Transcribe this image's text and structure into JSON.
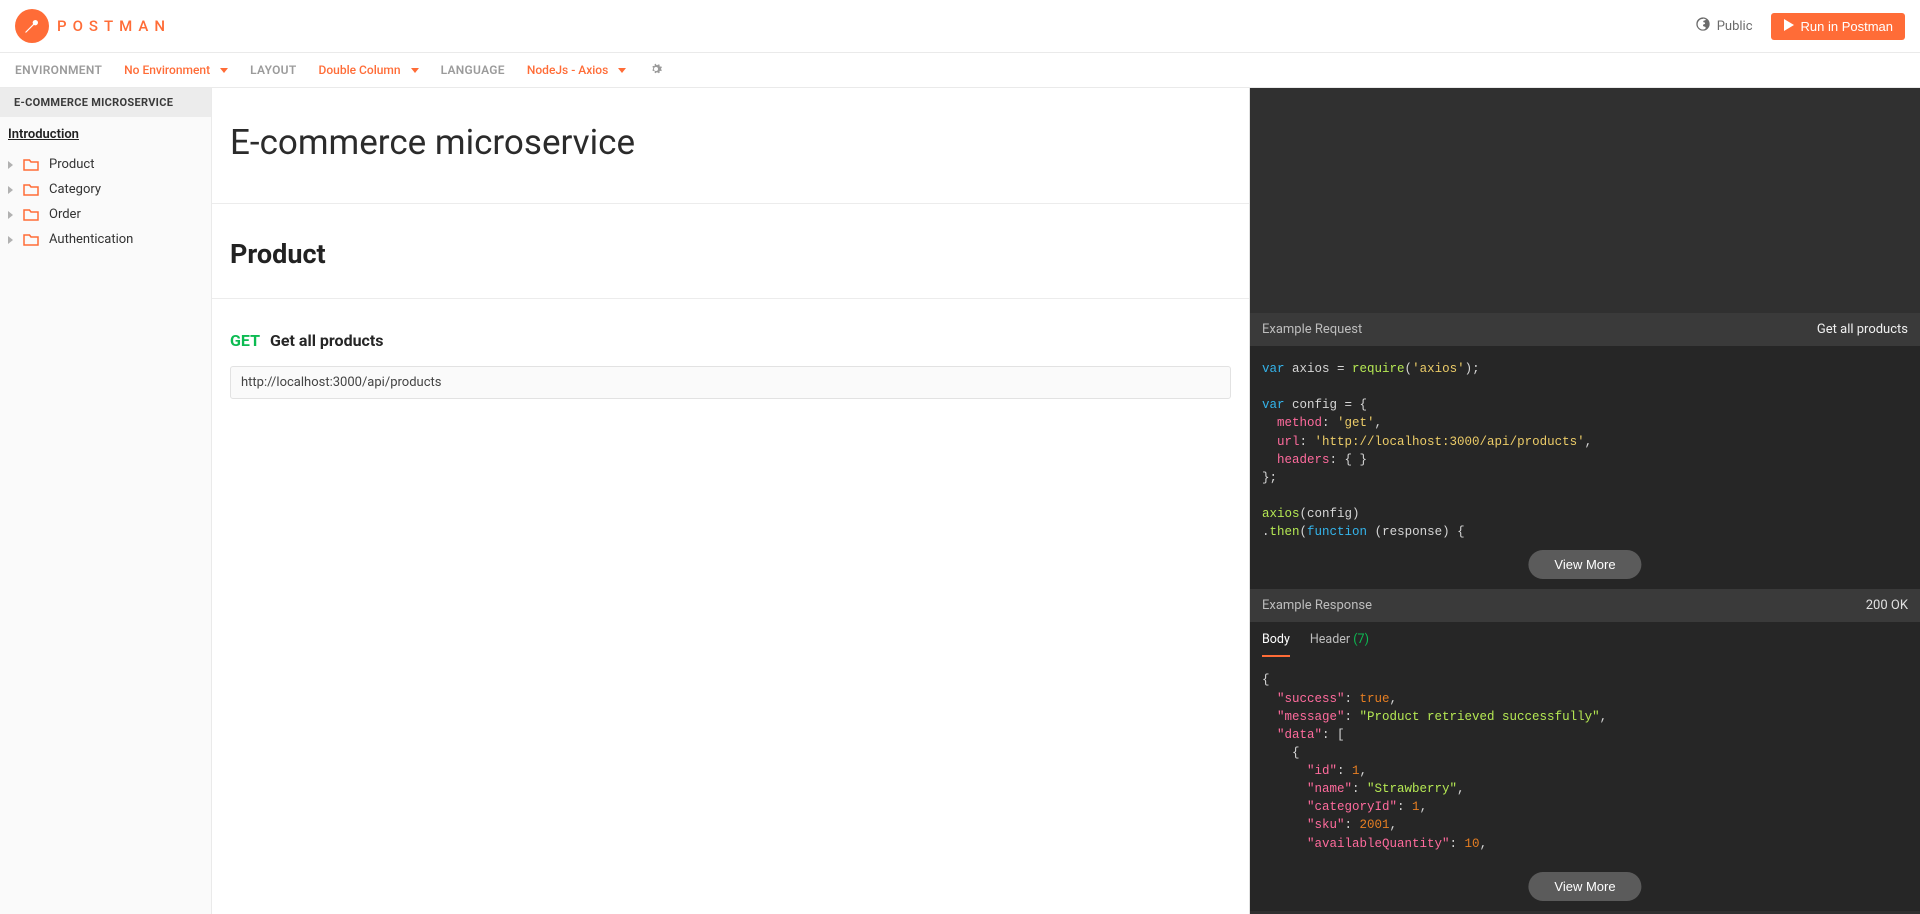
{
  "brand": "POSTMAN",
  "topbar": {
    "visibility": "Public",
    "run_btn": "Run in Postman"
  },
  "config": {
    "env_label": "ENVIRONMENT",
    "env_value": "No Environment",
    "layout_label": "LAYOUT",
    "layout_value": "Double Column",
    "lang_label": "LANGUAGE",
    "lang_value": "NodeJs - Axios"
  },
  "sidebar": {
    "title": "E-COMMERCE MICROSERVICE",
    "intro": "Introduction",
    "items": [
      "Product",
      "Category",
      "Order",
      "Authentication"
    ]
  },
  "main": {
    "title": "E-commerce microservice",
    "section": "Product",
    "request": {
      "method": "GET",
      "name": "Get all products",
      "url": "http://localhost:3000/api/products"
    }
  },
  "right": {
    "example_request_label": "Example Request",
    "example_request_name": "Get all products",
    "view_more": "View More",
    "example_response_label": "Example Response",
    "status": "200 OK",
    "tab_body": "Body",
    "tab_header": "Header",
    "header_count": "(7)",
    "code_request": {
      "l1a": "var",
      "l1b": " axios = ",
      "l1c": "require",
      "l1d": "(",
      "l1e": "'axios'",
      "l1f": ");",
      "l2a": "var",
      "l2b": " config = {",
      "l3a": "  method",
      "l3b": ": ",
      "l3c": "'get'",
      "l3d": ",",
      "l4a": "  url",
      "l4b": ": ",
      "l4c": "'http://localhost:3000/api/products'",
      "l4d": ",",
      "l5a": "  headers",
      "l5b": ": { }",
      "l6": "};",
      "l7a": "axios",
      "l7b": "(config)",
      "l8a": ".",
      "l8b": "then",
      "l8c": "(",
      "l8d": "function",
      "l8e": " (response) {"
    },
    "code_response": {
      "r1": "{",
      "r2a": "  \"success\"",
      "r2b": ": ",
      "r2c": "true",
      "r2d": ",",
      "r3a": "  \"message\"",
      "r3b": ": ",
      "r3c": "\"Product retrieved successfully\"",
      "r3d": ",",
      "r4a": "  \"data\"",
      "r4b": ": [",
      "r5": "    {",
      "r6a": "      \"id\"",
      "r6b": ": ",
      "r6c": "1",
      "r6d": ",",
      "r7a": "      \"name\"",
      "r7b": ": ",
      "r7c": "\"Strawberry\"",
      "r7d": ",",
      "r8a": "      \"categoryId\"",
      "r8b": ": ",
      "r8c": "1",
      "r8d": ",",
      "r9a": "      \"sku\"",
      "r9b": ": ",
      "r9c": "2001",
      "r9d": ",",
      "r10a": "      \"availableQuantity\"",
      "r10b": ": ",
      "r10c": "10",
      "r10d": ","
    }
  }
}
